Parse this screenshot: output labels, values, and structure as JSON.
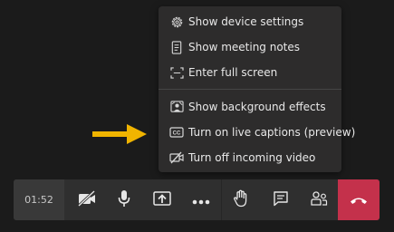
{
  "menu": {
    "items": [
      {
        "label": "Show device settings",
        "icon": "gear-icon"
      },
      {
        "label": "Show meeting notes",
        "icon": "notes-icon"
      },
      {
        "label": "Enter full screen",
        "icon": "fullscreen-icon"
      },
      {
        "label": "Show background effects",
        "icon": "background-effects-icon"
      },
      {
        "label": "Turn on live captions (preview)",
        "icon": "captions-icon"
      },
      {
        "label": "Turn off incoming video",
        "icon": "video-off-icon"
      }
    ]
  },
  "toolbar": {
    "timer": "01:52",
    "buttons": [
      {
        "name": "camera-off",
        "icon": "video-off-icon"
      },
      {
        "name": "microphone",
        "icon": "microphone-icon"
      },
      {
        "name": "share-screen",
        "icon": "share-tray-icon"
      },
      {
        "name": "more-actions",
        "icon": "ellipsis-icon"
      },
      {
        "name": "raise-hand",
        "icon": "hand-icon"
      },
      {
        "name": "chat",
        "icon": "chat-icon"
      },
      {
        "name": "participants",
        "icon": "people-icon"
      },
      {
        "name": "hang-up",
        "icon": "phone-hangup-icon"
      }
    ]
  },
  "colors": {
    "background": "#1b1b1b",
    "menu_bg": "#2d2c2c",
    "toolbar_bg": "#2f2f2f",
    "hangup": "#c4314b",
    "arrow": "#f0b400",
    "text": "#e8e8e8"
  }
}
